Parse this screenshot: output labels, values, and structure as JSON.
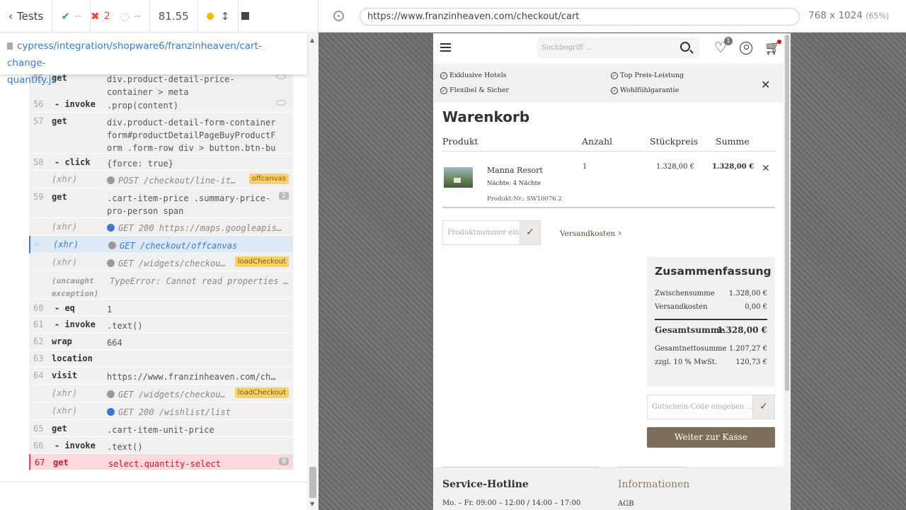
{
  "reporter": {
    "tests_label": "Tests",
    "passed": "--",
    "failed": "2",
    "pending": "--",
    "duration": "81.55",
    "spec_path_1": "cypress/integration/shopware6/franzinheaven/cart-change-",
    "spec_path_2": "quantity.js",
    "commands": [
      {
        "num": "55",
        "name": "get",
        "msg": "div.product-detail-price-container > meta"
      },
      {
        "num": "56",
        "name": "- invoke",
        "msg": ".prop(content)"
      },
      {
        "num": "57",
        "name": "get",
        "msg": "div.product-detail-form-container form#productDetailPageBuyProductForm .form-row div > button.btn-buy"
      },
      {
        "num": "58",
        "name": "- click",
        "msg": "{force: true}"
      },
      {
        "num": "",
        "name": "(xhr)",
        "msg": "POST /checkout/line-ite…",
        "tag": "offcanvas"
      },
      {
        "num": "59",
        "name": "get",
        "msg": ".cart-item-price .summary-price-pro-person span",
        "count": "2"
      },
      {
        "num": "",
        "name": "(xhr)",
        "msg": "GET 200 https://maps.googleapis…"
      },
      {
        "num": "",
        "name": "(xhr)",
        "msg": "GET /checkout/offcanvas"
      },
      {
        "num": "",
        "name": "(xhr)",
        "msg": "GET /widgets/checkou…",
        "tag": "loadCheckout"
      },
      {
        "num": "",
        "name": "(uncaught exception)",
        "msg": "TypeError: Cannot read properties …"
      },
      {
        "num": "60",
        "name": "- eq",
        "msg": "1"
      },
      {
        "num": "61",
        "name": "- invoke",
        "msg": ".text()"
      },
      {
        "num": "62",
        "name": "wrap",
        "msg": "664"
      },
      {
        "num": "63",
        "name": "location",
        "msg": ""
      },
      {
        "num": "64",
        "name": "visit",
        "msg": "https://www.franzinheaven.com/chec…"
      },
      {
        "num": "",
        "name": "(xhr)",
        "msg": "GET /widgets/checkou…",
        "tag": "loadCheckout"
      },
      {
        "num": "",
        "name": "(xhr)",
        "msg": "GET 200 /wishlist/list"
      },
      {
        "num": "65",
        "name": "get",
        "msg": ".cart-item-unit-price"
      },
      {
        "num": "66",
        "name": "- invoke",
        "msg": ".text()"
      },
      {
        "num": "67",
        "name": "get",
        "msg": "select.quantity-select",
        "count": "0"
      }
    ]
  },
  "aut": {
    "url": "https://www.franzinheaven.com/checkout/cart",
    "viewport": "768 x 1024",
    "scale": "(65%)"
  },
  "shop": {
    "search_placeholder": "Suchbegriff ...",
    "wishlist_count": "1",
    "usps": [
      "Exklusive Hotels",
      "Top Preis-Leistung",
      "Flexibel & Sicher",
      "Wohlfühlgarantie"
    ],
    "cart_title": "Warenkorb",
    "cols": {
      "product": "Produkt",
      "qty": "Anzahl",
      "unit": "Stückpreis",
      "sum": "Summe"
    },
    "item": {
      "name": "Manna Resort",
      "nights_label": "Nächte:",
      "nights_value": "4 Nächte",
      "product_nr": "Produkt-Nr.: SW10076.2",
      "qty": "1",
      "unit_price": "1.328,00 €",
      "sum": "1.328,00 €"
    },
    "product_nr_placeholder": "Produktnummer eingeben",
    "shipping_link": "Versandkosten",
    "summary": {
      "title": "Zusammenfassung",
      "subtotal_label": "Zwischensumme",
      "subtotal": "1.328,00 €",
      "shipping_label": "Versandkosten",
      "shipping": "0,00 €",
      "total_label": "Gesamtsumme",
      "total": "1.328,00 €",
      "net_label": "Gesamtnettosumme",
      "net": "1.207,27 €",
      "vat_label": "zzgl. 10 % MwSt.",
      "vat": "120,73 €"
    },
    "voucher_placeholder": "Gutschein-Code eingeben ...",
    "checkout_button": "Weiter zur Kasse",
    "footer": {
      "hotline_title": "Service-Hotline",
      "hotline_hours": "Mo. – Fr. 09:00 – 12:00 / 14:00 – 17:00",
      "info_title": "Informationen",
      "info_link": "AGB"
    }
  }
}
